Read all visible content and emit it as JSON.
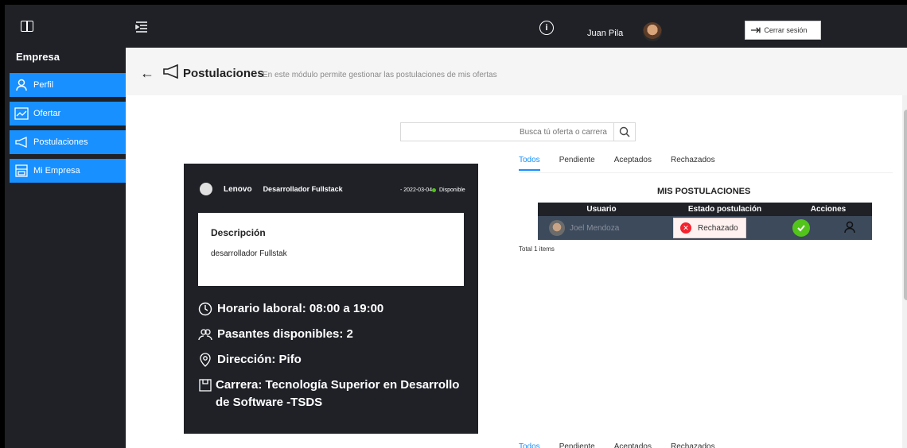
{
  "sidebar": {
    "logo_icon": "book-icon",
    "company_label": "Empresa",
    "items": [
      {
        "label": "Perfil",
        "icon": "user-icon"
      },
      {
        "label": "Ofertar",
        "icon": "line-chart-icon"
      },
      {
        "label": "Postulaciones",
        "icon": "megaphone-icon"
      },
      {
        "label": "Mi Empresa",
        "icon": "shop-icon"
      }
    ]
  },
  "topbar": {
    "menu_icon": "menu-fold-icon",
    "info_icon": "info-icon",
    "user_name": "Juan Pila",
    "logout_label": "Cerrar sesión"
  },
  "header": {
    "title": "Postulaciones",
    "subtitle": "En este módulo permite gestionar las postulaciones de mis ofertas"
  },
  "search": {
    "placeholder": "Busca tú oferta o carrera"
  },
  "offer": {
    "company": "Lenovo",
    "position": "Desarrollador Fullstack",
    "date": "- 2022-03-04",
    "status": "Disponible",
    "description_title": "Descripción",
    "description_text": "desarrollador Fullstak",
    "schedule": "Horario laboral: 08:00 a 19:00",
    "interns": "Pasantes disponibles: 2",
    "address": "Dirección: Pifo",
    "career": "Carrera: Tecnología Superior en Desarrollo de Software -TSDS"
  },
  "tabs": [
    "Todos",
    "Pendiente",
    "Aceptados",
    "Rechazados"
  ],
  "applications": {
    "title": "MIS POSTULACIONES",
    "columns": [
      "Usuario",
      "Estado postulación",
      "Acciones"
    ],
    "rows": [
      {
        "user": "Joel Mendoza",
        "state": "Rechazado"
      }
    ],
    "total": "Total 1 items"
  },
  "colors": {
    "accent": "#1890ff",
    "dark": "#1f2127",
    "success": "#52c41a",
    "danger": "#f5222d"
  }
}
